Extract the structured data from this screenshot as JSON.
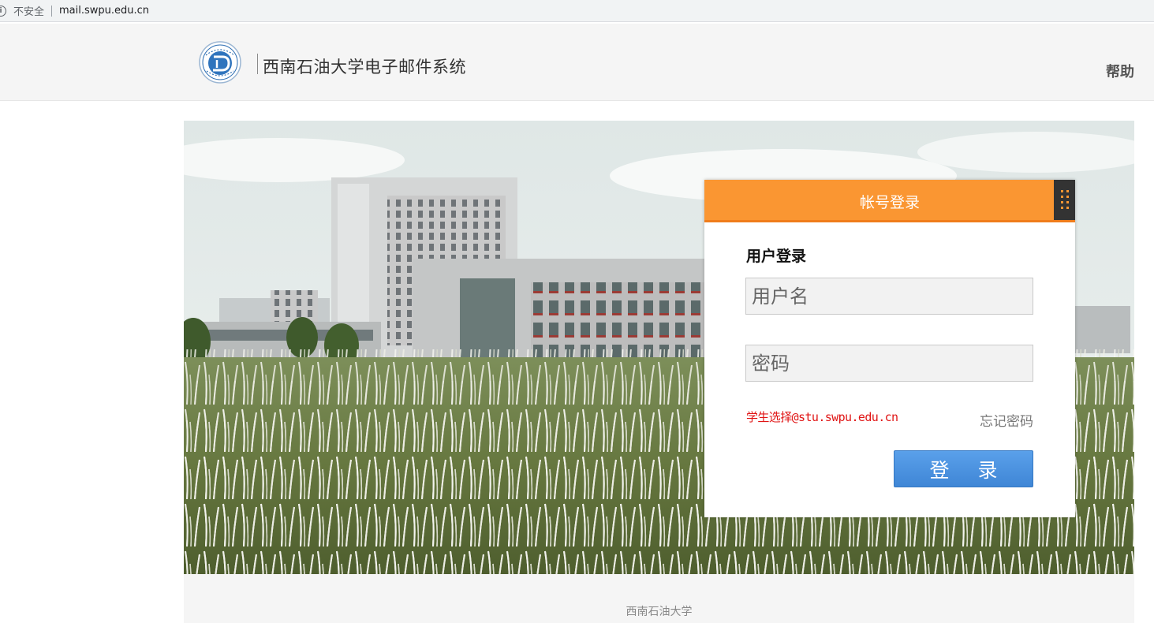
{
  "browser": {
    "security_label": "不安全",
    "url": "mail.swpu.edu.cn"
  },
  "header": {
    "title": "西南石油大学电子邮件系统",
    "help_label": "帮助"
  },
  "login": {
    "panel_title": "帐号登录",
    "subtitle": "用户登录",
    "username_placeholder": "用户名",
    "password_placeholder": "密码",
    "student_tip": "学生选择@stu.swpu.edu.cn",
    "forgot_label": "忘记密码",
    "submit_label": "登 录"
  },
  "footer": {
    "text": "西南石油大学"
  },
  "colors": {
    "accent_orange": "#fa9632",
    "button_blue": "#4a90e2",
    "tip_red": "#e01515"
  },
  "icons": {
    "address_info": "info-icon",
    "logo": "university-logo",
    "panel_grip": "grip-dots-icon"
  }
}
